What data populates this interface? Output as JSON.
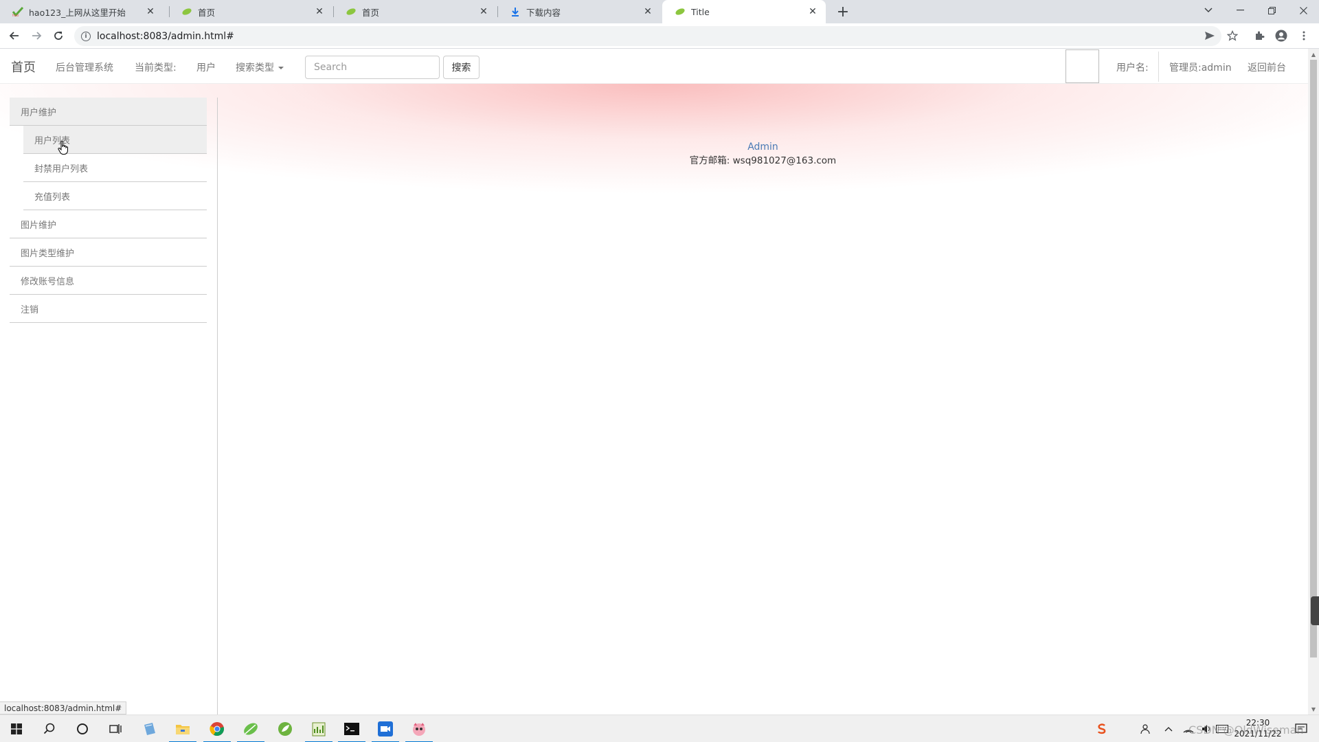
{
  "browser": {
    "tabs": [
      {
        "title": "hao123_上网从这里开始",
        "icon": "hao123-icon"
      },
      {
        "title": "首页",
        "icon": "leaf-icon"
      },
      {
        "title": "首页",
        "icon": "leaf-icon"
      },
      {
        "title": "下载内容",
        "icon": "download-icon"
      },
      {
        "title": "Title",
        "icon": "leaf-icon",
        "active": true
      }
    ],
    "url": "localhost:8083/admin.html#",
    "status_url": "localhost:8083/admin.html#"
  },
  "navbar": {
    "brand": "首页",
    "system": "后台管理系统",
    "current_type": "当前类型:",
    "user": "用户",
    "search_type": "搜索类型",
    "search_placeholder": "Search",
    "search_button": "搜索",
    "username_label": "用户名:",
    "admin": "管理员:admin",
    "back": "返回前台"
  },
  "sidebar": {
    "user_maintain": "用户维护",
    "sub_items": [
      "用户列表",
      "封禁用户列表",
      "充值列表"
    ],
    "items": [
      "图片维护",
      "图片类型维护",
      "修改账号信息",
      "注销"
    ]
  },
  "content": {
    "title": "Admin",
    "email": "官方邮箱: wsq981027@163.com"
  },
  "taskbar": {
    "time": "22:30",
    "date": "2021/11/22"
  },
  "watermark": "CSDN @OldWiseman",
  "colors": {
    "hero_pink": "#f9b2b2",
    "link_blue": "#4a7ab5",
    "taskbar_accent": "#0078d4"
  }
}
